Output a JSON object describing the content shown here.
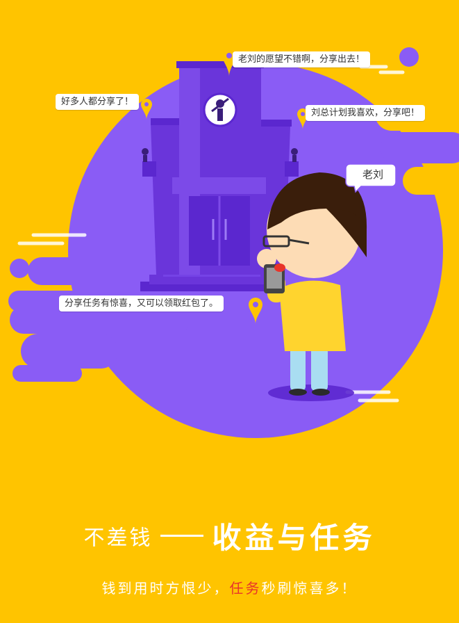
{
  "colors": {
    "background": "#FFC400",
    "purple": "#8A5CF5",
    "purple_dark": "#5B27CF",
    "white": "#FFFFFF",
    "highlight": "#E8342A"
  },
  "bubbles": {
    "top": "老刘的愿望不错啊，分享出去！",
    "left": "好多人都分享了！",
    "right": "刘总计划我喜欢，分享吧！",
    "bottom": "分享任务有惊喜，又可以领取红包了。",
    "name_tag": "老刘"
  },
  "headline": {
    "prefix": "不差钱",
    "title": "收益与任务"
  },
  "tagline": {
    "part1": "钱到用时方恨少，",
    "highlight": "任务",
    "part2": "秒刷惊喜多！"
  }
}
